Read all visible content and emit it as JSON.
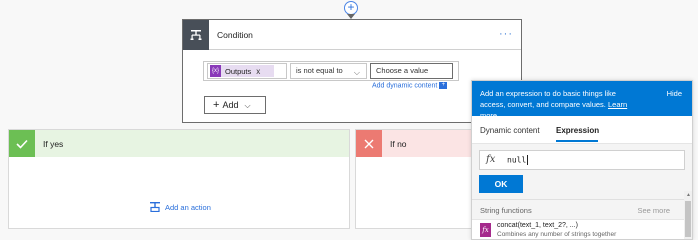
{
  "condition": {
    "title": "Condition",
    "more": "···",
    "token_label": "Outputs",
    "token_remove": "x",
    "operator": "is not equal to",
    "value_placeholder": "Choose a value",
    "dynamic_link": "Add dynamic content",
    "add_label": "Add"
  },
  "branches": {
    "yes_title": "If yes",
    "no_title": "If no",
    "add_action": "Add an action"
  },
  "panel": {
    "intro": "Add an expression to do basic things like access, convert, and compare values.",
    "learn_more": "Learn more",
    "hide": "Hide",
    "tabs": [
      "Dynamic content",
      "Expression"
    ],
    "active_tab": "Expression",
    "expression_value": "null",
    "ok_label": "OK",
    "section_title": "String functions",
    "see_more": "See more",
    "functions": [
      {
        "name": "concat(text_1, text_2?, ...)",
        "desc": "Combines any number of strings together"
      }
    ]
  },
  "colors": {
    "accent": "#0078d4",
    "yes": "#6cbf54",
    "no": "#ec7a72",
    "token": "#8a3ab9"
  },
  "icons": [
    "add-step-icon",
    "condition-icon",
    "checkmark-icon",
    "close-x-icon",
    "add-action-icon",
    "fx-icon"
  ]
}
